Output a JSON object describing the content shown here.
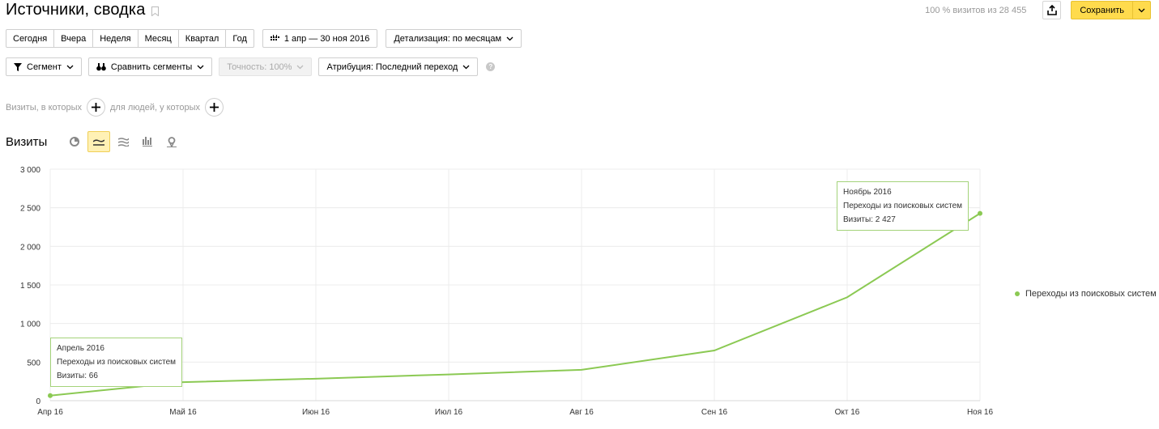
{
  "header": {
    "title": "Источники, сводка",
    "visits_share": "100 % визитов из 28 455",
    "save_label": "Сохранить"
  },
  "period": {
    "presets": [
      "Сегодня",
      "Вчера",
      "Неделя",
      "Месяц",
      "Квартал",
      "Год"
    ],
    "date_range": "1 апр — 30 ноя 2016",
    "detail": "Детализация: по месяцам"
  },
  "filters": {
    "segment": "Сегмент",
    "compare": "Сравнить сегменты",
    "accuracy": "Точность: 100%",
    "attribution": "Атрибуция: Последний переход",
    "help": "?"
  },
  "conditions": {
    "visits_where": "Визиты, в которых",
    "people_where": "для людей, у которых"
  },
  "chart_header": {
    "title": "Визиты"
  },
  "colors": {
    "series": "#8bc953",
    "accent": "#ffdb4d",
    "tooltip_border": "#a4d37a"
  },
  "chart_data": {
    "type": "line",
    "categories": [
      "Апр 16",
      "Май 16",
      "Июн 16",
      "Июл 16",
      "Авг 16",
      "Сен 16",
      "Окт 16",
      "Ноя 16"
    ],
    "series": [
      {
        "name": "Переходы из поисковых систем",
        "values": [
          66,
          240,
          285,
          340,
          400,
          650,
          1340,
          2427
        ]
      }
    ],
    "y_ticks": [
      "0",
      "500",
      "1 000",
      "1 500",
      "2 000",
      "2 500",
      "3 000"
    ],
    "ylim": [
      0,
      3000
    ],
    "grid": true,
    "legend": "right",
    "tooltips": [
      {
        "title": "Апрель 2016",
        "series": "Переходы из поисковых систем",
        "value": "Визиты: 66"
      },
      {
        "title": "Ноябрь 2016",
        "series": "Переходы из поисковых систем",
        "value": "Визиты: 2 427"
      }
    ]
  }
}
